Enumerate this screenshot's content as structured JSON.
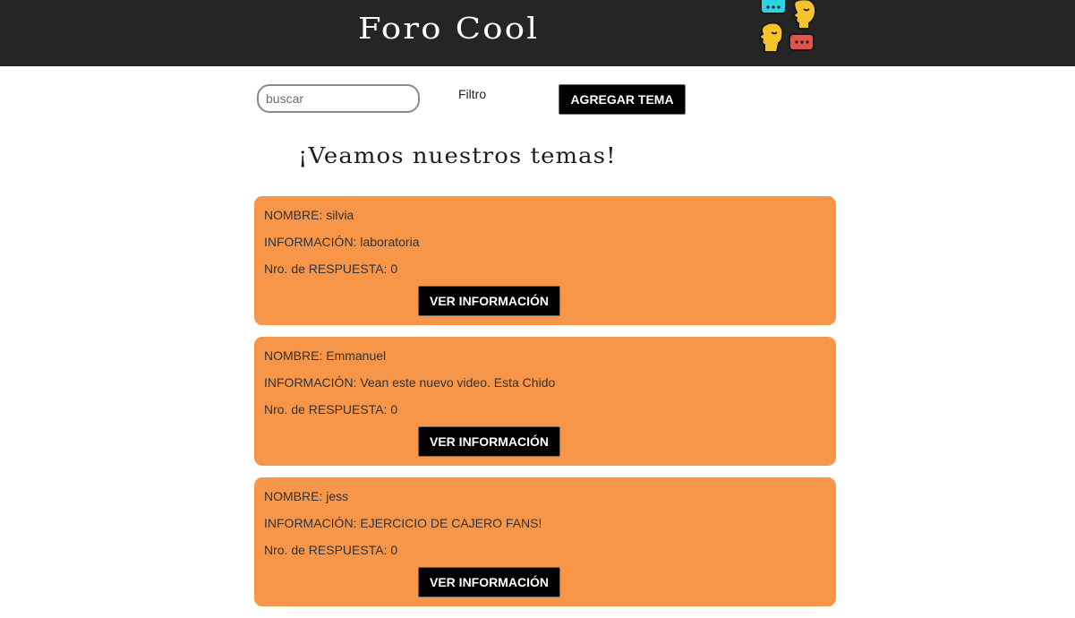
{
  "header": {
    "title": "Foro Cool",
    "logo_icon": "chat-people-logo"
  },
  "toolbar": {
    "search_placeholder": "buscar",
    "search_value": "",
    "filter_label": "Filtro",
    "add_topic_label": "AGREGAR TEMA"
  },
  "main": {
    "heading": "¡Veamos nuestros temas!",
    "topics": [
      {
        "name_line": "NOMBRE: silvia",
        "info_line": "INFORMACIÓN: laboratoria",
        "replies_line": "Nro. de RESPUESTA: 0",
        "button_label": "VER INFORMACIÓN"
      },
      {
        "name_line": "NOMBRE: Emmanuel",
        "info_line": "INFORMACIÓN: Vean este nuevo video. Esta Chido",
        "replies_line": "Nro. de RESPUESTA: 0",
        "button_label": "VER INFORMACIÓN"
      },
      {
        "name_line": "NOMBRE: jess",
        "info_line": "INFORMACIÓN: EJERCICIO DE CAJERO FANS!",
        "replies_line": "Nro. de RESPUESTA: 0",
        "button_label": "VER INFORMACIÓN"
      }
    ]
  },
  "colors": {
    "header_bg": "#252525",
    "card_bg": "#f79548",
    "button_bg": "#000000",
    "logo_cyan": "#2ad4e4",
    "logo_yellow": "#f5c32c",
    "logo_red": "#e2544b"
  }
}
